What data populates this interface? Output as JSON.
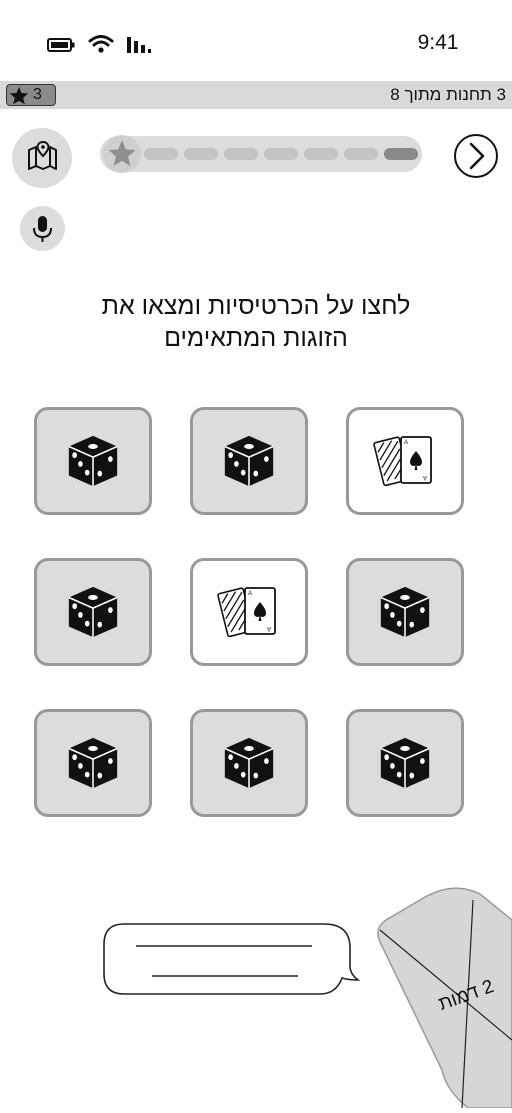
{
  "status_bar": {
    "time": "9:41"
  },
  "progress_strip": {
    "star_count": "3",
    "stations_text": "3 תחנות מתוך 8"
  },
  "progress": {
    "total_segments": 7,
    "completed_segments": 1
  },
  "instruction": {
    "line1": "לחצו על הכרטיסיות ומצאו את",
    "line2": "הזוגות המתאימים"
  },
  "cards": [
    {
      "state": "open",
      "icon": "playing-cards-icon"
    },
    {
      "state": "closed",
      "icon": "dice-icon"
    },
    {
      "state": "closed",
      "icon": "dice-icon"
    },
    {
      "state": "closed",
      "icon": "dice-icon"
    },
    {
      "state": "open",
      "icon": "playing-cards-icon"
    },
    {
      "state": "closed",
      "icon": "dice-icon"
    },
    {
      "state": "closed",
      "icon": "dice-icon"
    },
    {
      "state": "closed",
      "icon": "dice-icon"
    },
    {
      "state": "closed",
      "icon": "dice-icon"
    }
  ],
  "characters_card": {
    "label": "2 דמות"
  },
  "colors": {
    "strip_bg": "#d9d9d9",
    "card_bg": "#dcdcdc",
    "card_border": "#999999",
    "progress_active": "#8a8a8a"
  }
}
